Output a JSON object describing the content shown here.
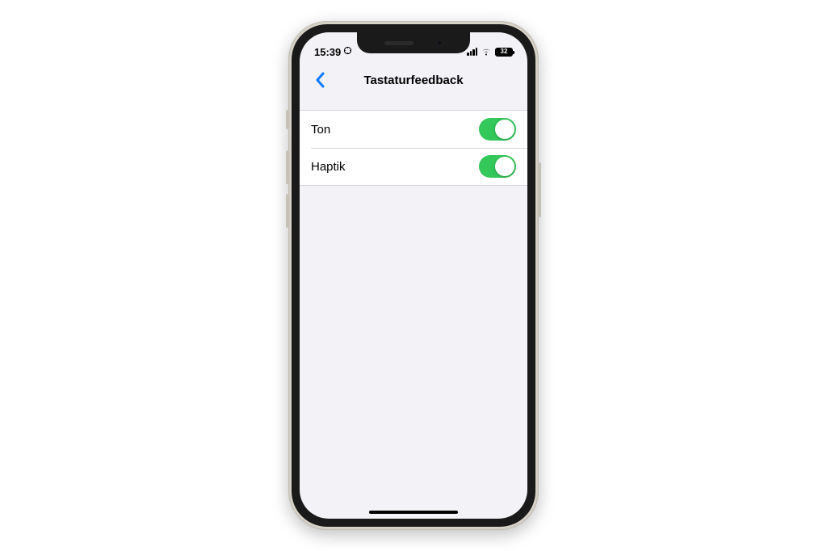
{
  "status_bar": {
    "time": "15:39",
    "battery_level": "32"
  },
  "header": {
    "title": "Tastaturfeedback"
  },
  "settings": {
    "rows": [
      {
        "label": "Ton",
        "on": true
      },
      {
        "label": "Haptik",
        "on": true
      }
    ]
  },
  "colors": {
    "accent": "#007aff",
    "toggle_on": "#34c759",
    "background": "#f2f2f7"
  }
}
